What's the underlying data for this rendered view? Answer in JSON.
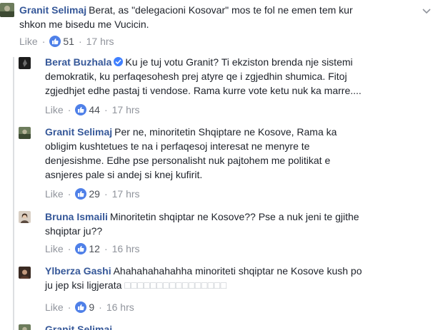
{
  "comments": [
    {
      "author": "Granit Selimaj",
      "text_lines": [
        "Berat, as \"delegacioni Kosovar\" mos te fol ne emen tem kur",
        "shkon me bisedu me Vucicin."
      ],
      "like_label": "Like",
      "reaction_count": "51",
      "time": "17 hrs"
    },
    {
      "author": "Berat Buzhala",
      "verified": true,
      "text_lines": [
        "Ku je tuj votu Granit? Ti ekziston brenda nje sistemi",
        "demokratik, ku perfaqesohesh prej atyre qe i zgjedhin shumica. Fitoj",
        "zgjedhjet edhe pastaj ti vendose. Rama kurre vote ketu nuk ka marre...."
      ],
      "like_label": "Like",
      "reaction_count": "44",
      "time": "17 hrs"
    },
    {
      "author": "Granit Selimaj",
      "text_lines": [
        "Per ne, minoritetin Shqiptare ne Kosove, Rama ka",
        "obligim kushtetues te na i perfaqesoj interesat ne menyre te",
        "denjesishme. Edhe pse personalisht nuk pajtohem me politikat e",
        "asnjeres pale si andej si knej kufirit."
      ],
      "like_label": "Like",
      "reaction_count": "29",
      "time": "17 hrs"
    },
    {
      "author": "Bruna Ismaili",
      "text_lines": [
        "Minoritetin shqiptar ne Kosove?? Pse a nuk jeni te gjithe",
        "shqiptar ju??"
      ],
      "like_label": "Like",
      "reaction_count": "12",
      "time": "16 hrs"
    },
    {
      "author": "Ylberza Gashi",
      "text_lines": [
        "Ahahahahahahha minoriteti shqiptar ne Kosove kush po",
        "ju jep ksi ligjerata"
      ],
      "trailing_boxes": "□□□□□□□□□□□□□□□□",
      "like_label": "Like",
      "reaction_count": "9",
      "time": "16 hrs"
    },
    {
      "author": "Granit Selimaj",
      "text_lines": []
    }
  ],
  "icons": {
    "reaction": "thumbs-up-icon",
    "verified": "verified-badge-icon",
    "options": "chevron-down-icon"
  },
  "colors": {
    "author": "#365899",
    "reaction": "#4f80e8",
    "meta": "#90949c",
    "verified": "#4080ff"
  }
}
